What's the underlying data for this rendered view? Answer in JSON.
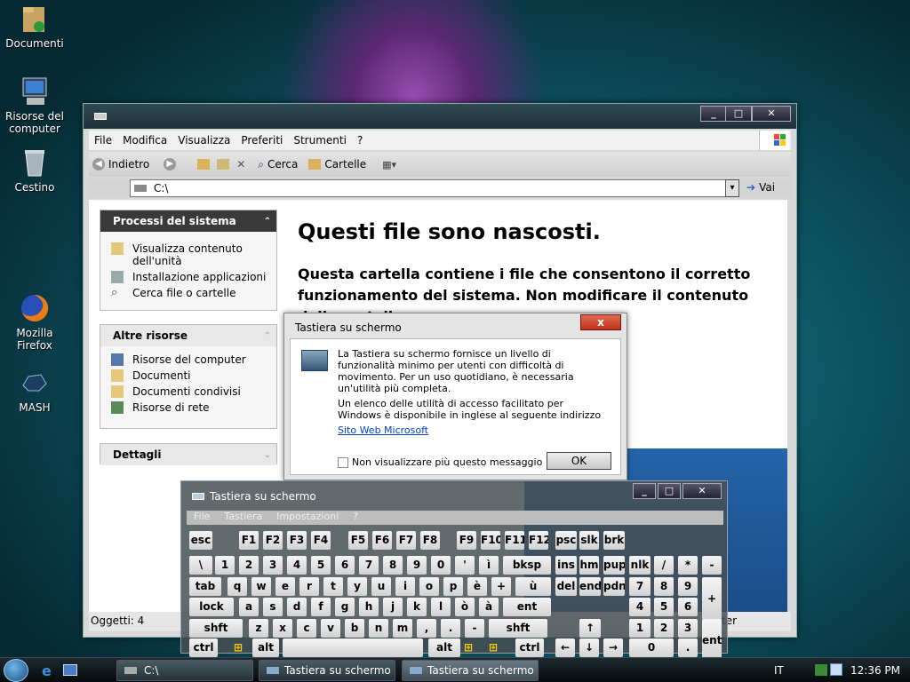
{
  "desktop": {
    "icons": [
      {
        "label": "Documenti",
        "icon": "folder-icon"
      },
      {
        "label": "Risorse del computer",
        "icon": "computer-icon"
      },
      {
        "label": "Cestino",
        "icon": "recycle-bin-icon"
      },
      {
        "label": "Mozilla Firefox",
        "icon": "firefox-icon"
      },
      {
        "label": "MASH",
        "icon": "mash-icon"
      }
    ]
  },
  "explorer": {
    "menu": [
      "File",
      "Modifica",
      "Visualizza",
      "Preferiti",
      "Strumenti",
      "?"
    ],
    "toolbar": {
      "back": "Indietro",
      "search": "Cerca",
      "folders": "Cartelle"
    },
    "address": {
      "value": "C:\\",
      "go": "Vai"
    },
    "panels": [
      {
        "title": "Processi del sistema",
        "items": [
          "Visualizza contenuto dell'unità",
          "Installazione applicazioni",
          "Cerca file o cartelle"
        ]
      },
      {
        "title": "Altre risorse",
        "items": [
          "Risorse del computer",
          "Documenti",
          "Documenti condivisi",
          "Risorse di rete"
        ]
      },
      {
        "title": "Dettagli",
        "items": []
      }
    ],
    "heading": "Questi file sono nascosti.",
    "body": "Questa cartella contiene i file che consentono il corretto funzionamento del sistema. Non modificare il contenuto della cartella.",
    "status": "Oggetti: 4",
    "status_right": "ter"
  },
  "dialog": {
    "title": "Tastiera su schermo",
    "close": "x",
    "text1": "La Tastiera su schermo fornisce un livello di funzionalità minimo per utenti con difficoltà di movimento. Per un uso quotidiano, è necessaria un'utilità più completa.",
    "text2": "Un elenco delle utilità di accesso facilitato per Windows è disponibile in inglese al seguente indirizzo",
    "link": "Sito Web Microsoft",
    "checkbox": "Non visualizzare più questo messaggio",
    "ok": "OK"
  },
  "osk": {
    "title": "Tastiera su schermo",
    "menu": [
      "File",
      "Tastiera",
      "Impostazioni",
      "?"
    ],
    "rows": [
      [
        "esc",
        "F1",
        "F2",
        "F3",
        "F4",
        "F5",
        "F6",
        "F7",
        "F8",
        "F9",
        "F10",
        "F11",
        "F12",
        "psc",
        "slk",
        "brk"
      ],
      [
        "\\",
        "1",
        "2",
        "3",
        "4",
        "5",
        "6",
        "7",
        "8",
        "9",
        "0",
        "'",
        "ì",
        "bksp",
        "ins",
        "hm",
        "pup",
        "nlk",
        "/",
        "*",
        "-"
      ],
      [
        "tab",
        "q",
        "w",
        "e",
        "r",
        "t",
        "y",
        "u",
        "i",
        "o",
        "p",
        "è",
        "+",
        "ù",
        "del",
        "end",
        "pdn",
        "7",
        "8",
        "9",
        "+"
      ],
      [
        "lock",
        "a",
        "s",
        "d",
        "f",
        "g",
        "h",
        "j",
        "k",
        "l",
        "ò",
        "à",
        "ent",
        "4",
        "5",
        "6"
      ],
      [
        "shft",
        "z",
        "x",
        "c",
        "v",
        "b",
        "n",
        "m",
        ",",
        ".",
        "-",
        "shft",
        "↑",
        "1",
        "2",
        "3",
        "ent"
      ],
      [
        "ctrl",
        "alt",
        "alt",
        "ctrl",
        "←",
        "↓",
        "→",
        "0",
        "."
      ]
    ]
  },
  "taskbar": {
    "tasks": [
      "C:\\",
      "Tastiera su schermo",
      "Tastiera su schermo"
    ],
    "lang": "IT",
    "clock": "12:36 PM"
  }
}
